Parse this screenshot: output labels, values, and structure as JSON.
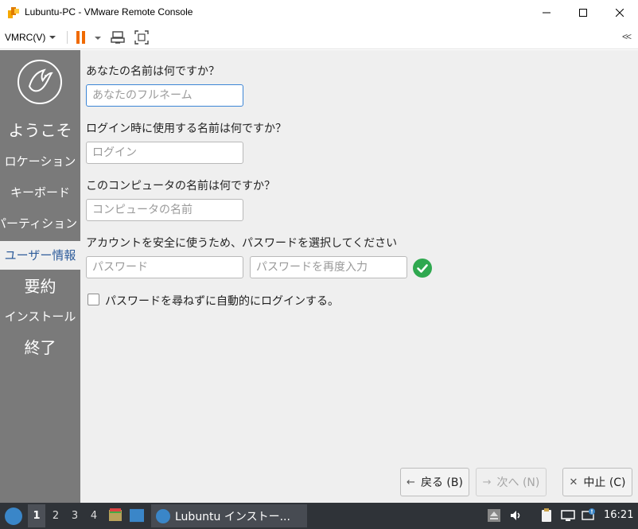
{
  "window": {
    "title": "Lubuntu-PC - VMware Remote Console"
  },
  "toolbar": {
    "vmrc_menu": "VMRC(V)",
    "collapse": "<<"
  },
  "sidebar": {
    "steps": [
      {
        "label": "ようこそ",
        "active": false
      },
      {
        "label": "ロケーション",
        "active": false
      },
      {
        "label": "キーボード",
        "active": false
      },
      {
        "label": "パーティション",
        "active": false
      },
      {
        "label": "ユーザー情報",
        "active": true
      },
      {
        "label": "要約",
        "active": false
      },
      {
        "label": "インストール",
        "active": false
      },
      {
        "label": "終了",
        "active": false
      }
    ]
  },
  "form": {
    "name_question": "あなたの名前は何ですか？",
    "name_placeholder": "あなたのフルネーム",
    "login_question": "ログイン時に使用する名前は何ですか？",
    "login_placeholder": "ログイン",
    "computer_question": "このコンピュータの名前は何ですか？",
    "computer_placeholder": "コンピュータの名前",
    "password_question": "アカウントを安全に使うため、パスワードを選択してください",
    "password_placeholder": "パスワード",
    "password_repeat_placeholder": "パスワードを再度入力",
    "autologin_label": "パスワードを尋ねずに自動的にログインする。",
    "autologin_checked": false
  },
  "buttons": {
    "back": "戻る (B)",
    "next": "次へ (N)",
    "cancel": "中止 (C)"
  },
  "taskbar": {
    "workspaces": [
      "1",
      "2",
      "3",
      "4"
    ],
    "active_workspace": "1",
    "task_label": "Lubuntu インストー...",
    "clock": "16:21"
  },
  "colors": {
    "sidebar_bg": "#7a7a7a",
    "active_step_text": "#2f5d9b",
    "focus_border": "#3d86d6",
    "ok_green": "#2fa84f",
    "pause_orange": "#f06a00"
  }
}
